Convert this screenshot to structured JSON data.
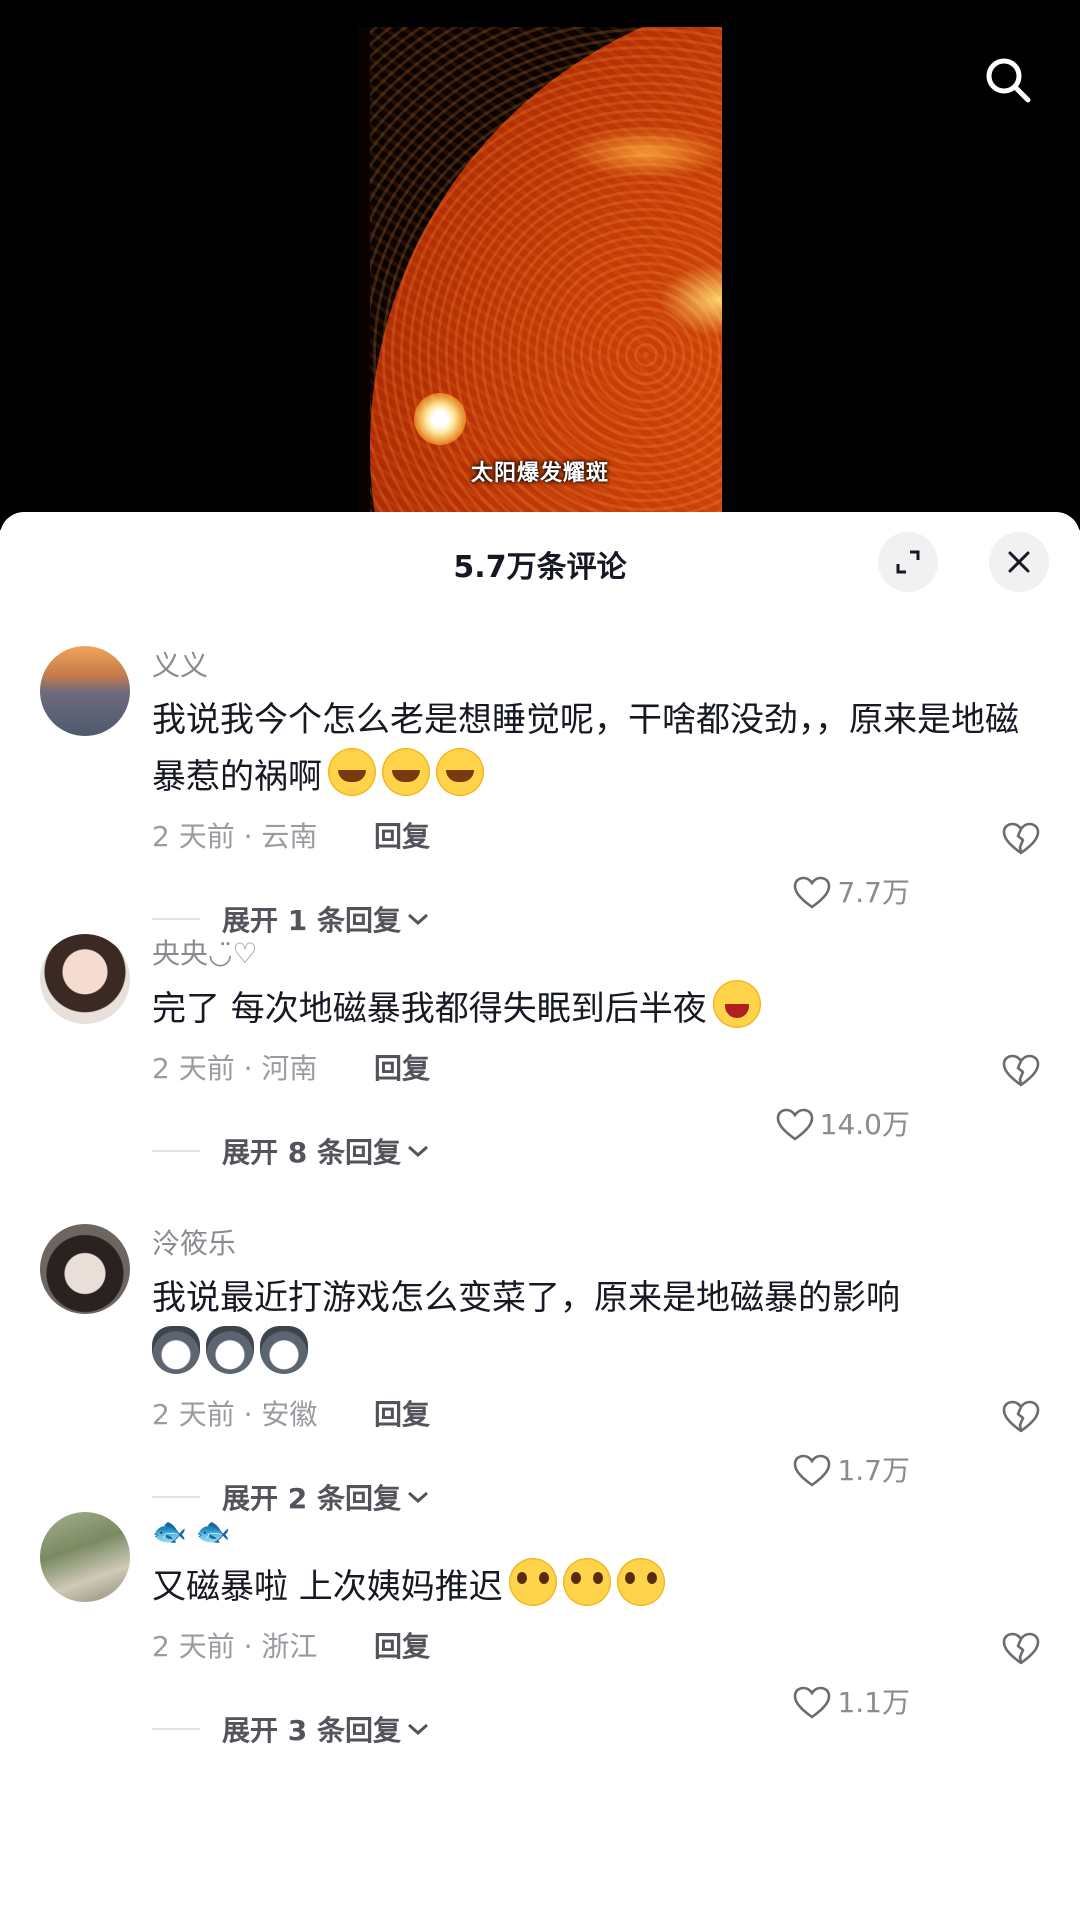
{
  "video": {
    "caption": "太阳爆发耀斑"
  },
  "top_bar": {
    "search_icon": "search-icon"
  },
  "comments_sheet": {
    "title": "5.7万条评论",
    "expand_icon": "expand-icon",
    "close_icon": "close-icon",
    "comments": [
      {
        "username": "义义",
        "text": "我说我今个怎么老是想睡觉呢，干啥都没劲，，原来是地磁暴惹的祸啊",
        "emojis": [
          "crying-face",
          "crying-face",
          "crying-face"
        ],
        "time_location": "2 天前 · 云南",
        "reply_label": "回复",
        "likes": "7.7万",
        "expand_label": "展开 1 条回复"
      },
      {
        "username": "央央◡̈♡",
        "text": "完了 每次地磁暴我都得失眠到后半夜",
        "emojis": [
          "laughing-crying-face"
        ],
        "time_location": "2 天前 · 河南",
        "reply_label": "回复",
        "likes": "14.0万",
        "expand_label": "展开 8 条回复"
      },
      {
        "username": "泠筱乐",
        "text": "我说最近打游戏怎么变菜了，原来是地磁暴的影响",
        "emojis": [
          "husky",
          "husky",
          "husky"
        ],
        "time_location": "2 天前 · 安徽",
        "reply_label": "回复",
        "likes": "1.7万",
        "expand_label": "展开 2 条回复"
      },
      {
        "username": "🐟 🐟",
        "text": "又磁暴啦 上次姨妈推迟",
        "emojis": [
          "pleading-face",
          "pleading-face",
          "pleading-face"
        ],
        "time_location": "2 天前 · 浙江",
        "reply_label": "回复",
        "likes": "1.1万",
        "expand_label": "展开 3 条回复"
      }
    ]
  },
  "colors": {
    "primary_text": "#161823",
    "secondary_text": "#8a8b91",
    "sheet_bg": "#ffffff",
    "video_bg": "#000000"
  }
}
